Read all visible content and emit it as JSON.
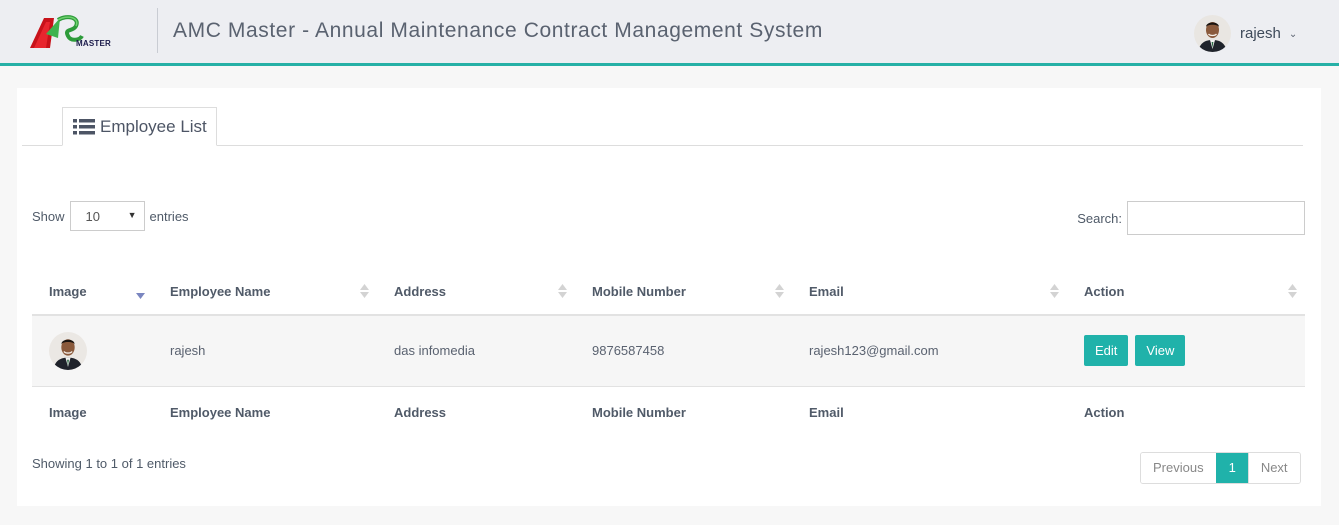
{
  "header": {
    "logo_text": "MASTER",
    "title": "AMC Master - Annual Maintenance Contract Management System",
    "user_name": "rajesh",
    "icons": {
      "avatar": "user-photo",
      "caret": "chevron-down-icon"
    }
  },
  "tabs": [
    {
      "label": "Employee List",
      "icon": "list-icon"
    }
  ],
  "controls": {
    "show_label": "Show",
    "page_length": "10",
    "entries_label": "entries",
    "search_label": "Search:",
    "search_value": ""
  },
  "table": {
    "columns": [
      "Image",
      "Employee Name",
      "Address",
      "Mobile Number",
      "Email",
      "Action"
    ],
    "sorted_column": "Image",
    "sort_direction": "descending",
    "rows": [
      {
        "image": "employee-photo",
        "name": "rajesh",
        "address": "das infomedia",
        "mobile": "9876587458",
        "email": "rajesh123@gmail.com",
        "actions": [
          "Edit",
          "View"
        ]
      }
    ]
  },
  "footer": {
    "info": "Showing 1 to 1 of 1 entries",
    "pagination": {
      "previous": "Previous",
      "current": "1",
      "next": "Next"
    }
  },
  "colors": {
    "accent": "#20b2aa",
    "header_bg": "#edeef2",
    "page_bg": "#f7f7f7"
  }
}
